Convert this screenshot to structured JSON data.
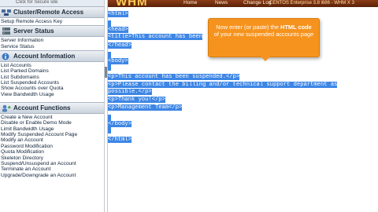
{
  "sidebar": {
    "top_link": "Click for Secure site",
    "sections": [
      {
        "title": "Cluster/Remote Access",
        "icon": "cluster-icon",
        "items": [
          "Setup Remote Access Key"
        ]
      },
      {
        "title": "Server Status",
        "icon": "server-icon",
        "items": [
          "Server Information",
          "Service Status"
        ]
      },
      {
        "title": "Account Information",
        "icon": "info-icon",
        "items": [
          "List Accounts",
          "List Parked Domains",
          "List Subdomains",
          "List Suspended Accounts",
          "Show Accounts over Quota",
          "View Bandwidth Usage"
        ]
      },
      {
        "title": "Account Functions",
        "icon": "functions-icon",
        "items": [
          "Create a New Account",
          "Disable or Enable Demo Mode",
          "Limit Bandwidth Usage",
          "Modify Suspended Account Page",
          "Modify an Account",
          "Password Modification",
          "Quota Modification",
          "Skeleton Directory",
          "Suspend/Unsuspend an Account",
          "Terminate an Account",
          "Upgrade/Downgrade an Account"
        ]
      }
    ]
  },
  "topbar": {
    "logo": "WHM",
    "nav": [
      "Home",
      "News",
      "Change Log"
    ],
    "version": "CENTOS Enterprise 3.8 i686 - WHM X 3"
  },
  "editor": {
    "lines": [
      "<html>",
      "",
      "<head>",
      "<title>This account has been",
      "</head>",
      "",
      "<body>",
      "",
      "<p>This account has been suspended.</p>",
      "<p>Please contact the billing and/or technical support department as",
      "possible.</p>",
      "<p>Thank you!</p>",
      "<p>Management Team</p>",
      "",
      "</body>",
      "",
      "</html>"
    ]
  },
  "tooltip": {
    "before": "Now enter (or paste) the ",
    "bold": "HTML code",
    "after": " of your new suspended accounts page"
  },
  "colors": {
    "selection": "#3d86e5",
    "tooltip": "#f6931e",
    "topbar": "#6e2c0e"
  }
}
